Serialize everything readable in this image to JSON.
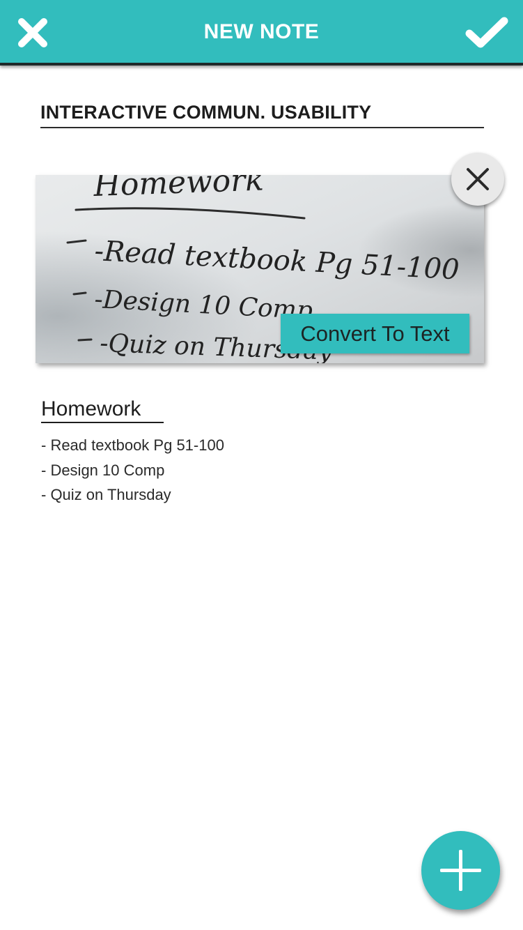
{
  "header": {
    "title": "NEW NOTE",
    "close_icon": "close-icon",
    "confirm_icon": "checkmark-icon"
  },
  "note": {
    "title": "INTERACTIVE COMMUN. USABILITY"
  },
  "photo": {
    "remove_icon": "close-icon",
    "convert_label": "Convert To Text",
    "handwriting": {
      "heading": "Homework",
      "lines": [
        "-Read textbook Pg 51-100",
        "-Design 10 Comp",
        "-Quiz on Thursday"
      ]
    }
  },
  "converted": {
    "heading": "Homework",
    "lines": [
      "- Read textbook Pg 51-100",
      "- Design 10 Comp",
      "- Quiz on Thursday"
    ]
  },
  "fab": {
    "icon": "plus-icon"
  },
  "colors": {
    "accent": "#32bdbd",
    "header_shadow": "#1f2a2a",
    "text": "#1d1d1d"
  }
}
